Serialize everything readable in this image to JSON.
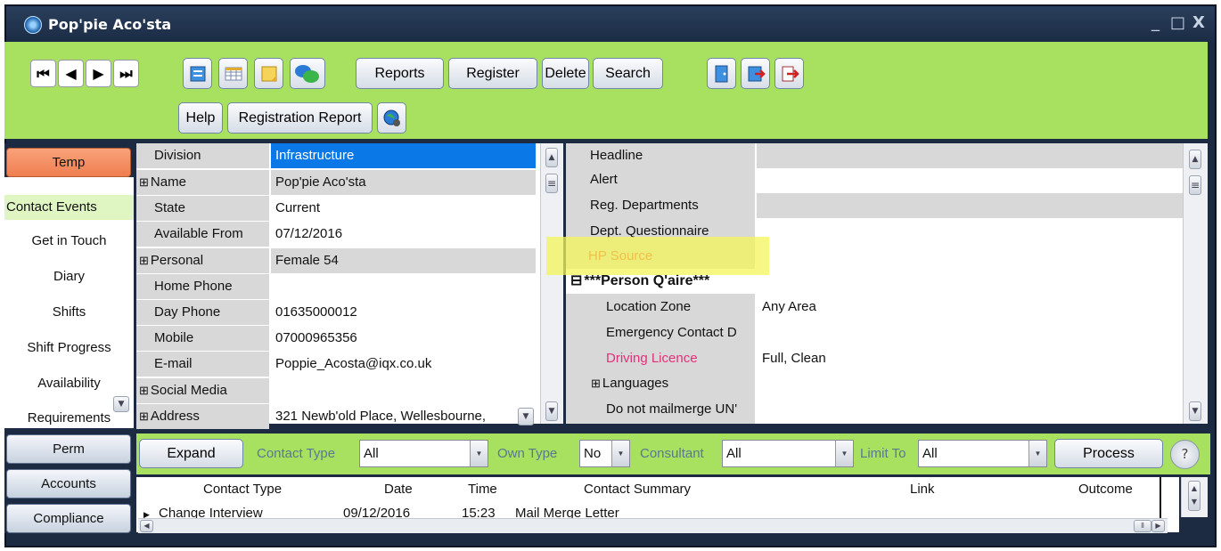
{
  "window": {
    "title": "Pop'pie Aco'sta",
    "controls": [
      "_",
      "□",
      "X"
    ]
  },
  "toolbar": {
    "nav": [
      "⏮",
      "◀",
      "▶",
      "⏭"
    ],
    "icons_row1": [
      "form-icon",
      "grid-icon",
      "note-icon",
      "chat-icon"
    ],
    "reports_label": "Reports",
    "register_label": "Register",
    "delete_label": "Delete",
    "search_label": "Search",
    "icons_row1b": [
      "exit-icon",
      "reload-icon",
      "logout-icon"
    ],
    "help_label": "Help",
    "registration_report_label": "Registration Report",
    "globe_icon": "globe-icon"
  },
  "sidebar": {
    "temp_label": "Temp",
    "items": [
      "Contact Events",
      "Get in Touch",
      "Diary",
      "Shifts",
      "Shift Progress",
      "Availability",
      "Requirements"
    ],
    "perm_label": "Perm",
    "accounts_label": "Accounts",
    "compliance_label": "Compliance"
  },
  "left_fields": [
    {
      "label": "Division",
      "value": "Infrastructure",
      "expand": false
    },
    {
      "label": "Name",
      "value": "Pop'pie Aco'sta",
      "expand": true
    },
    {
      "label": "State",
      "value": "Current",
      "expand": false
    },
    {
      "label": "Available From",
      "value": "07/12/2016",
      "expand": false
    },
    {
      "label": "Personal",
      "value": "Female 54",
      "expand": true
    },
    {
      "label": "Home Phone",
      "value": "",
      "expand": false
    },
    {
      "label": "Day Phone",
      "value": "01635000012",
      "expand": false
    },
    {
      "label": "Mobile",
      "value": "07000965356",
      "expand": false
    },
    {
      "label": "E-mail",
      "value": "Poppie_Acosta@iqx.co.uk",
      "expand": false
    },
    {
      "label": "Social Media",
      "value": "",
      "expand": true
    },
    {
      "label": "Address",
      "value": "321 Newb'old Place, Wellesbourne,",
      "expand": true
    }
  ],
  "right_fields": [
    {
      "label": "Headline",
      "value": ""
    },
    {
      "label": "Alert",
      "value": ""
    },
    {
      "label": "Reg. Departments",
      "value": ""
    },
    {
      "label": "Dept. Questionnaire",
      "value": ""
    },
    {
      "label": "HP Source",
      "value": ""
    },
    {
      "label": "***Person Q'aire***",
      "value": ""
    },
    {
      "label": "Location Zone",
      "value": "Any Area"
    },
    {
      "label": "Emergency Contact D",
      "value": ""
    },
    {
      "label": "Driving Licence",
      "value": "Full, Clean"
    },
    {
      "label": "Languages",
      "value": ""
    },
    {
      "label": "Do not mailmerge UN'",
      "value": ""
    }
  ],
  "contact_bar": {
    "expand_label": "Expand",
    "contact_type_label": "Contact Type",
    "contact_type_value": "All",
    "own_type_label": "Own Type",
    "own_type_value": "No",
    "consultant_label": "Consultant",
    "consultant_value": "All",
    "limit_to_label": "Limit To",
    "limit_to_value": "All",
    "process_label": "Process",
    "help_label": "?"
  },
  "contact_table": {
    "headers": [
      "Contact Type",
      "Date",
      "Time",
      "Contact Summary",
      "Link",
      "Outcome"
    ],
    "rows": [
      [
        "Change Interview",
        "09/12/2016",
        "15:23",
        "Mail Merge Letter",
        "",
        ""
      ]
    ]
  },
  "colors": {
    "accent_green": "#a8e05f",
    "window_bg": "#1d2b42",
    "selection": "#0a78e6",
    "temp_button": "#f08a5d",
    "hp_source": "#e8201c",
    "driving_licence": "#e0307a"
  }
}
